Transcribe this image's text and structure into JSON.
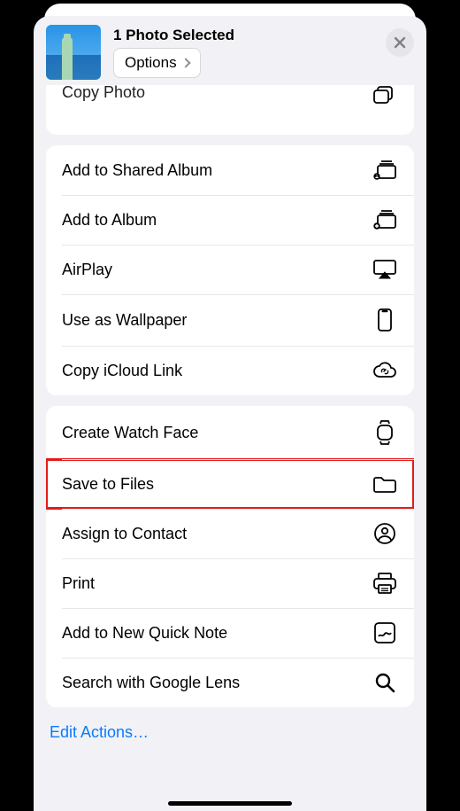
{
  "header": {
    "title": "1 Photo Selected",
    "options_label": "Options"
  },
  "group0": {
    "copy_photo": "Copy Photo"
  },
  "group1": {
    "shared_album": "Add to Shared Album",
    "add_album": "Add to Album",
    "airplay": "AirPlay",
    "wallpaper": "Use as Wallpaper",
    "icloud_link": "Copy iCloud Link"
  },
  "group2": {
    "watch_face": "Create Watch Face",
    "save_files": "Save to Files",
    "assign_contact": "Assign to Contact",
    "print": "Print",
    "quick_note": "Add to New Quick Note",
    "google_lens": "Search with Google Lens"
  },
  "footer": {
    "edit_actions": "Edit Actions…"
  }
}
